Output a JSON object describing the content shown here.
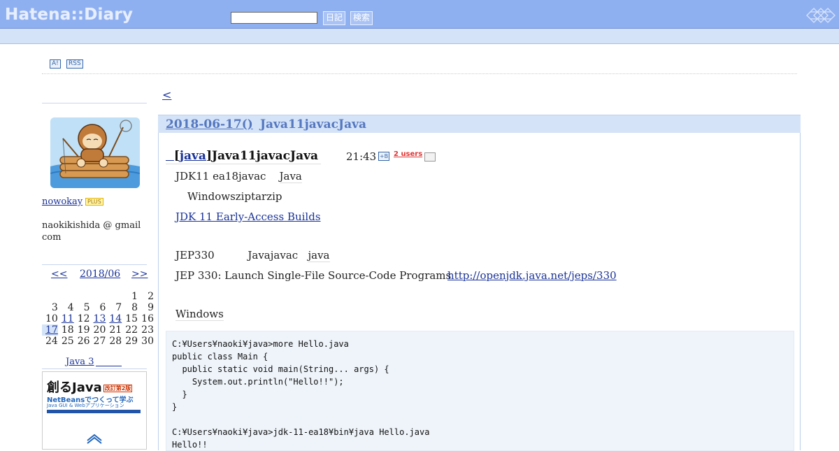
{
  "header": {
    "logo": "Hatena::Diary",
    "search_placeholder": "",
    "diary_button": "日記",
    "search_button": "検索"
  },
  "toolbar": {
    "antenna": "A!",
    "rss": "RSS"
  },
  "nav": {
    "prev": "<"
  },
  "profile": {
    "username": "nowokay",
    "plus_badge": "PLUS",
    "email": "naokikishida @ gmail com"
  },
  "calendar": {
    "prev": "<<",
    "month": "2018/06",
    "next": ">>",
    "weeks": [
      [
        "",
        "",
        "",
        "",
        "",
        "1",
        "2"
      ],
      [
        "3",
        "4",
        "5",
        "6",
        "7",
        "8",
        "9"
      ],
      [
        "10",
        "11",
        "12",
        "13",
        "14",
        "15",
        "16"
      ],
      [
        "17",
        "18",
        "19",
        "20",
        "21",
        "22",
        "23"
      ],
      [
        "24",
        "25",
        "26",
        "27",
        "28",
        "29",
        "30"
      ]
    ],
    "linked_days": [
      "11",
      "13",
      "14",
      "17"
    ],
    "today": "17"
  },
  "sidebar_link": "Java 3",
  "book": {
    "title": "創るJava",
    "edition": "改訂第2版",
    "subtitle": "NetBeansでつくって学ぶ",
    "subtitle2": "Java GUI & Webアプリケーション"
  },
  "day": {
    "date": "2018-06-17()",
    "title": "Java11javacJava"
  },
  "entry": {
    "category": "java",
    "title": "Java11javacJava",
    "time": "21:43",
    "b_icon": "+B",
    "users": "2 users",
    "lines": {
      "p1": "JDK11 ea18javac",
      "p1_java": "Java",
      "p2": "Windowsziptarzip",
      "link1": "JDK 11 Early-Access Builds",
      "p3": "JEP330",
      "p3_javajavac": "Javajavac",
      "p3_java": "java",
      "p4": "JEP 330: Launch Single-File Source-Code Programs",
      "link2": "http://openjdk.java.net/jeps/330",
      "p5": "Windows"
    },
    "code": "C:¥Users¥naoki¥java>more Hello.java\npublic class Main {\n  public static void main(String... args) {\n    System.out.println(\"Hello!!\");\n  }\n}\n\nC:¥Users¥naoki¥java>jdk-11-ea18¥bin¥java Hello.java\nHello!!"
  },
  "colors": {
    "topbar": "#8fb0f0",
    "subbar": "#d4e3f7",
    "link": "#1a3399",
    "users_red": "#e23434"
  }
}
